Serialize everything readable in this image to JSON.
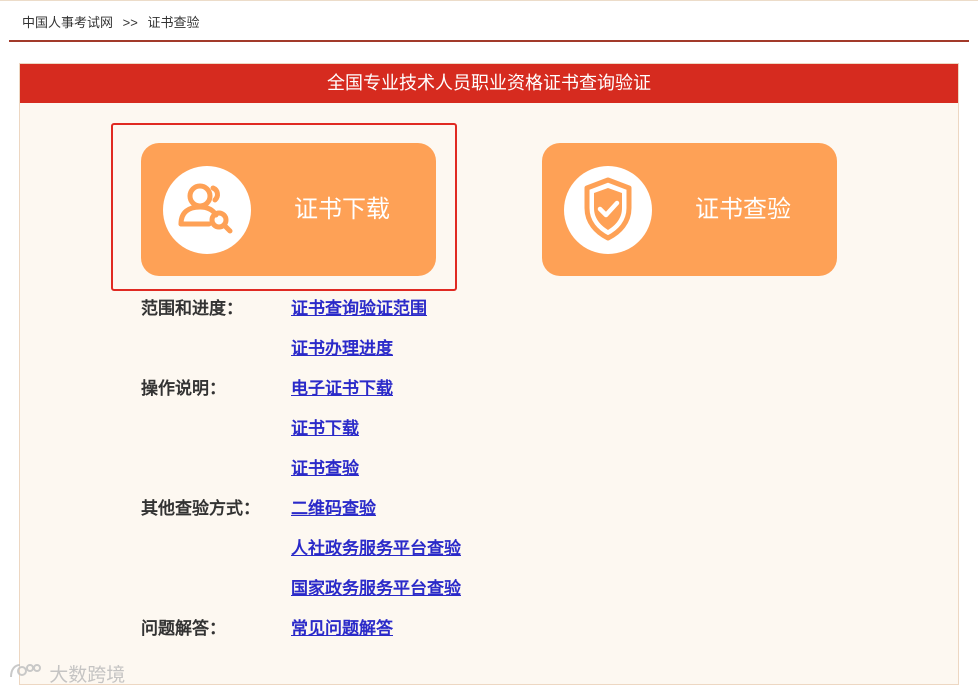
{
  "breadcrumb": {
    "home": "中国人事考试网",
    "separator": ">>",
    "current": "证书查验"
  },
  "panel": {
    "title": "全国专业技术人员职业资格证书查询验证"
  },
  "tiles": {
    "download": {
      "label": "证书下载",
      "icon": "user-search-icon"
    },
    "verify": {
      "label": "证书查验",
      "icon": "shield-check-icon"
    }
  },
  "sections": {
    "scope": {
      "label": "范围和进度：",
      "links": [
        "证书查询验证范围",
        "证书办理进度"
      ]
    },
    "guide": {
      "label": "操作说明：",
      "links": [
        "电子证书下载",
        "证书下载",
        "证书查验"
      ]
    },
    "other": {
      "label": "其他查验方式：",
      "links": [
        "二维码查验",
        "人社政务服务平台查验",
        "国家政务服务平台查验"
      ]
    },
    "faq": {
      "label": "问题解答：",
      "links": [
        "常见问题解答"
      ]
    }
  },
  "watermark": {
    "text": "大数跨境"
  },
  "colors": {
    "header_red": "#d62b1f",
    "tile_orange": "#fea156",
    "link_blue": "#2b2ac9",
    "highlight_red": "#e02a22"
  }
}
